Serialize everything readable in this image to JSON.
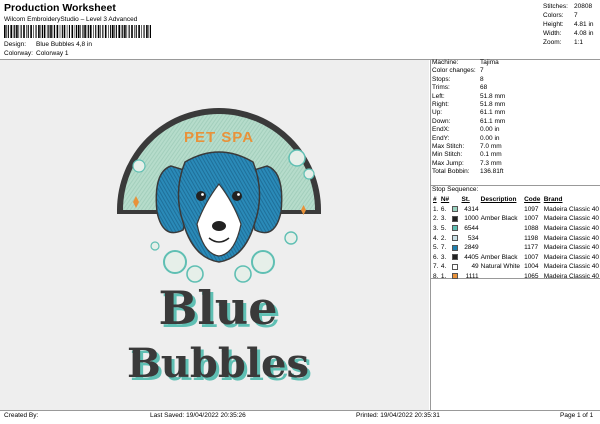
{
  "header": {
    "title": "Production Worksheet",
    "subtitle": "Wilcom EmbroideryStudio – Level 3 Advanced",
    "design_label": "Design:",
    "design_value": "Blue Bubbles 4,8 in",
    "colorway_label": "Colorway:",
    "colorway_value": "Colorway 1"
  },
  "stats": [
    {
      "label": "Stitches:",
      "value": "20808"
    },
    {
      "label": "Colors:",
      "value": "7"
    },
    {
      "label": "Height:",
      "value": "4.81 in"
    },
    {
      "label": "Width:",
      "value": "4.08 in"
    },
    {
      "label": "Zoom:",
      "value": "1:1"
    }
  ],
  "properties": [
    {
      "label": "Machine:",
      "value": "Tajima"
    },
    {
      "label": "Color changes:",
      "value": "7"
    },
    {
      "label": "Stops:",
      "value": "8"
    },
    {
      "label": "Trims:",
      "value": "68"
    },
    {
      "label": "Left:",
      "value": "51.8 mm"
    },
    {
      "label": "Right:",
      "value": "51.8 mm"
    },
    {
      "label": "Up:",
      "value": "61.1 mm"
    },
    {
      "label": "Down:",
      "value": "61.1 mm"
    },
    {
      "label": "EndX:",
      "value": "0.00 in"
    },
    {
      "label": "EndY:",
      "value": "0.00 in"
    },
    {
      "label": "Max Stitch:",
      "value": "7.0 mm"
    },
    {
      "label": "Min Stitch:",
      "value": "0.1 mm"
    },
    {
      "label": "Max Jump:",
      "value": "7.3 mm"
    },
    {
      "label": "Total Bobbin:",
      "value": "136.81ft"
    }
  ],
  "sequence": {
    "heading": "Stop Sequence:",
    "columns": [
      "#",
      "N#",
      "",
      "St.",
      "Description",
      "Code",
      "Brand"
    ],
    "rows": [
      {
        "num": "1.",
        "n": "6.",
        "color": "#9bd3c0",
        "st": "4314",
        "desc": "",
        "code": "1097",
        "brand": "Madeira Classic 40"
      },
      {
        "num": "2.",
        "n": "3.",
        "color": "#222222",
        "st": "1000",
        "desc": "Amber Black",
        "code": "1007",
        "brand": "Madeira Classic 40"
      },
      {
        "num": "3.",
        "n": "5.",
        "color": "#5fbfb3",
        "st": "6544",
        "desc": "",
        "code": "1088",
        "brand": "Madeira Classic 40"
      },
      {
        "num": "4.",
        "n": "2.",
        "color": "#c9dfe6",
        "st": "534",
        "desc": "",
        "code": "1198",
        "brand": "Madeira Classic 40"
      },
      {
        "num": "5.",
        "n": "7.",
        "color": "#1f7fae",
        "st": "2849",
        "desc": "",
        "code": "1177",
        "brand": "Madeira Classic 40"
      },
      {
        "num": "6.",
        "n": "3.",
        "color": "#222222",
        "st": "4405",
        "desc": "Amber Black",
        "code": "1007",
        "brand": "Madeira Classic 40"
      },
      {
        "num": "7.",
        "n": "4.",
        "color": "#ffffff",
        "st": "49",
        "desc": "Natural White",
        "code": "1004",
        "brand": "Madeira Classic 40"
      },
      {
        "num": "8.",
        "n": "1.",
        "color": "#e8923a",
        "st": "1111",
        "desc": "",
        "code": "1065",
        "brand": "Madeira Classic 40"
      }
    ]
  },
  "artwork": {
    "top_text": "PET SPA",
    "line1": "Blue",
    "line2": "Bubbles",
    "colors": {
      "mint": "#b6dccb",
      "teal": "#5fbfb3",
      "blue": "#2a7fb0",
      "orange": "#e8923a",
      "dark": "#3a3a3a"
    }
  },
  "footer": {
    "created_by": "Created By:",
    "last_saved": "Last Saved: 19/04/2022 20:35:26",
    "printed": "Printed: 19/04/2022 20:35:31",
    "page": "Page 1 of 1"
  }
}
